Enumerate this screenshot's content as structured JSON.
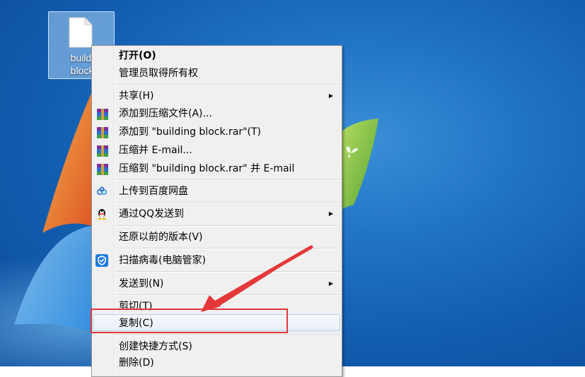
{
  "desktop": {
    "icon": {
      "name": "building block",
      "line1": "buildi",
      "line2": "block"
    }
  },
  "menu": {
    "items": [
      {
        "label": "打开(O)",
        "bold": true
      },
      {
        "label": "管理员取得所有权"
      },
      {
        "label": "共享(H)",
        "submenu": true
      },
      {
        "label": "添加到压缩文件(A)...",
        "icon": "winrar-icon"
      },
      {
        "label": "添加到 \"building block.rar\"(T)",
        "icon": "winrar-icon"
      },
      {
        "label": "压缩并 E-mail...",
        "icon": "winrar-icon"
      },
      {
        "label": "压缩到 \"building block.rar\" 并 E-mail",
        "icon": "winrar-icon"
      },
      {
        "label": "上传到百度网盘",
        "icon": "baidu-netdisk-icon"
      },
      {
        "label": "通过QQ发送到",
        "icon": "qq-penguin-icon",
        "submenu": true
      },
      {
        "label": "还原以前的版本(V)"
      },
      {
        "label": "扫描病毒(电脑管家)",
        "icon": "tencent-shield-icon"
      },
      {
        "label": "发送到(N)",
        "submenu": true
      },
      {
        "label": "剪切(T)"
      },
      {
        "label": "复制(C)",
        "highlighted": true
      },
      {
        "label": "创建快捷方式(S)"
      },
      {
        "label": "删除(D)"
      }
    ]
  },
  "colors": {
    "annotation": "#e5383a",
    "menu_background": "#f0f0f0",
    "highlight_border": "#aecff7"
  }
}
